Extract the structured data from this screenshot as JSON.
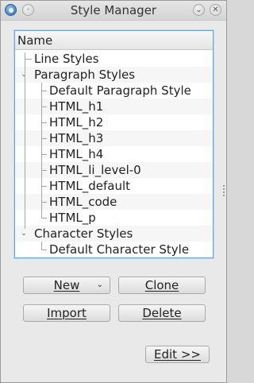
{
  "window": {
    "title": "Style Manager"
  },
  "titlebar_icons": {
    "app": "app-menu-icon",
    "minimize": "minimize-icon",
    "close": "close-icon"
  },
  "tree": {
    "column_header": "Name",
    "rows": [
      {
        "label": "Line Styles",
        "level": 0,
        "expandable": false
      },
      {
        "label": "Paragraph Styles",
        "level": 0,
        "expandable": true,
        "expanded": true
      },
      {
        "label": "Default Paragraph Style",
        "level": 1
      },
      {
        "label": "HTML_h1",
        "level": 1
      },
      {
        "label": "HTML_h2",
        "level": 1
      },
      {
        "label": "HTML_h3",
        "level": 1
      },
      {
        "label": "HTML_h4",
        "level": 1
      },
      {
        "label": "HTML_li_level-0",
        "level": 1
      },
      {
        "label": "HTML_default",
        "level": 1
      },
      {
        "label": "HTML_code",
        "level": 1
      },
      {
        "label": "HTML_p",
        "level": 1
      },
      {
        "label": "Character Styles",
        "level": 0,
        "expandable": true,
        "expanded": true
      },
      {
        "label": "Default Character Style",
        "level": 1
      }
    ]
  },
  "buttons": {
    "new_label": "New",
    "clone_label": "Clone",
    "import_label": "Import",
    "delete_label": "Delete",
    "edit_label": "Edit >>"
  },
  "colors": {
    "selection_border": "#6da3d6",
    "window_bg": "#e9e9e9"
  }
}
